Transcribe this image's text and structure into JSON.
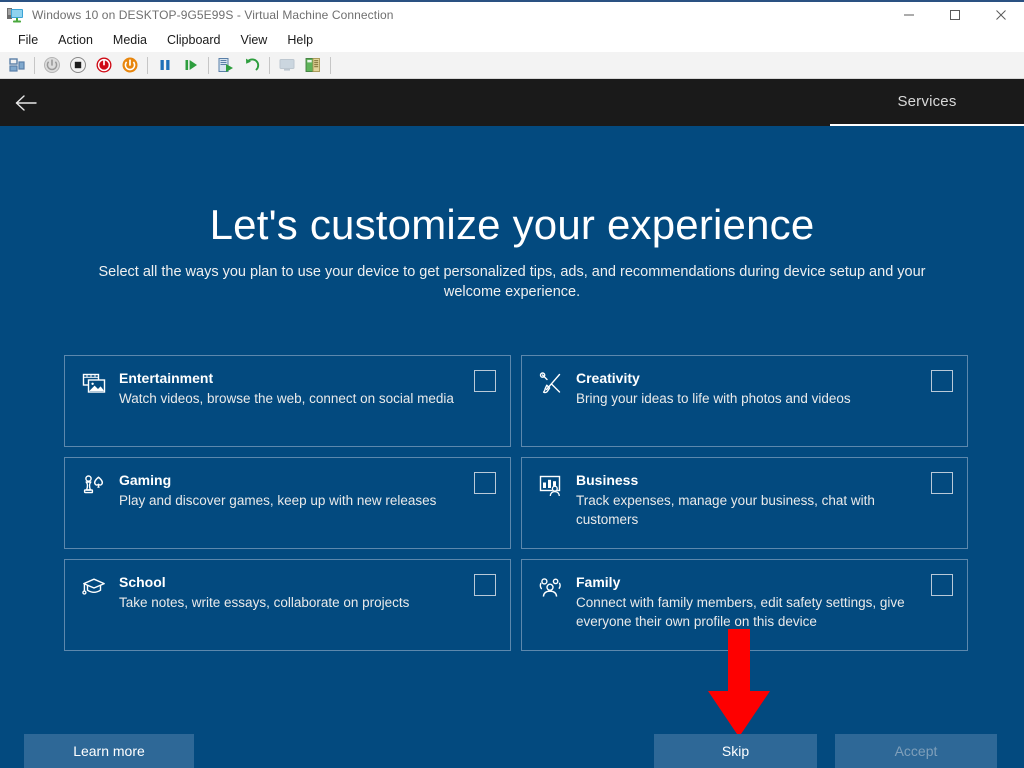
{
  "window": {
    "title": "Windows 10 on DESKTOP-9G5E99S - Virtual Machine Connection",
    "title_icon": "virtual-machine-icon",
    "controls": {
      "minimize": "minimize-icon",
      "maximize": "maximize-icon",
      "close": "close-icon"
    }
  },
  "menubar": {
    "items": [
      {
        "label": "File"
      },
      {
        "label": "Action"
      },
      {
        "label": "Media"
      },
      {
        "label": "Clipboard"
      },
      {
        "label": "View"
      },
      {
        "label": "Help"
      }
    ]
  },
  "toolbar": {
    "items": [
      {
        "name": "ctrl-alt-del-icon"
      },
      {
        "name": "start-icon"
      },
      {
        "name": "shutdown-icon"
      },
      {
        "name": "turn-off-icon"
      },
      {
        "name": "reset-icon"
      },
      {
        "name": "pause-icon"
      },
      {
        "name": "resume-icon"
      },
      {
        "name": "checkpoint-icon"
      },
      {
        "name": "revert-icon"
      },
      {
        "name": "enhanced-session-icon"
      },
      {
        "name": "settings-icon"
      }
    ]
  },
  "oobe": {
    "back_label": "back-arrow-icon",
    "tab_label": "Services",
    "title": "Let's customize your experience",
    "subtitle": "Select all the ways you plan to use your device to get personalized tips, ads, and recommendations during device setup and your welcome experience.",
    "cards": [
      {
        "id": "entertainment",
        "icon": "entertainment-media-icon",
        "title": "Entertainment",
        "desc": "Watch videos, browse the web, connect on social media",
        "checked": false
      },
      {
        "id": "creativity",
        "icon": "creativity-pen-brush-icon",
        "title": "Creativity",
        "desc": "Bring your ideas to life with photos and videos",
        "checked": false
      },
      {
        "id": "gaming",
        "icon": "gaming-pawn-spade-icon",
        "title": "Gaming",
        "desc": "Play and discover games, keep up with new releases",
        "checked": false
      },
      {
        "id": "business",
        "icon": "business-chart-person-icon",
        "title": "Business",
        "desc": "Track expenses, manage your business, chat with customers",
        "checked": false
      },
      {
        "id": "school",
        "icon": "school-graduation-cap-icon",
        "title": "School",
        "desc": "Take notes, write essays, collaborate on projects",
        "checked": false
      },
      {
        "id": "family",
        "icon": "family-people-icon",
        "title": "Family",
        "desc": "Connect with family members, edit safety settings, give everyone their own profile on this device",
        "checked": false
      }
    ],
    "footer": {
      "learn_more": "Learn more",
      "skip": "Skip",
      "accept": "Accept"
    },
    "annotation": {
      "arrow": "red-down-arrow-pointing-to-skip"
    },
    "colors": {
      "background": "#034a7f",
      "header": "#1a1a1a",
      "card_border": "#5d88ad",
      "button": "#2e6897",
      "arrow": "#fe0000"
    }
  }
}
